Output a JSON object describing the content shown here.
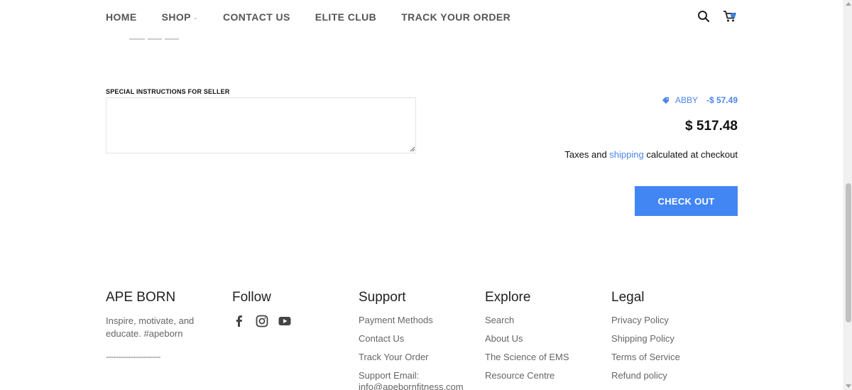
{
  "nav": {
    "home": "HOME",
    "shop": "SHOP",
    "contact": "CONTACT US",
    "elite": "ELITE CLUB",
    "track": "TRACK YOUR ORDER"
  },
  "header_icons": [
    "search-icon",
    "cart-icon"
  ],
  "accent_color": "#4286f4",
  "cart": {
    "special_instructions_label": "SPECIAL INSTRUCTIONS FOR SELLER",
    "special_instructions_value": "",
    "discount_code": "ABBY",
    "discount_amount": "-$ 57.49",
    "total": "$ 517.48",
    "taxes_prefix": "Taxes and",
    "taxes_link": "shipping",
    "taxes_suffix": "calculated at checkout",
    "checkout_label": "CHECK OUT"
  },
  "footer": {
    "brand": {
      "title": "APE BORN",
      "blurb": "Inspire, motivate, and educate. #apeborn",
      "dashes": "----------------------"
    },
    "follow": {
      "title": "Follow",
      "icons": [
        "facebook-icon",
        "instagram-icon",
        "youtube-icon"
      ]
    },
    "support": {
      "title": "Support",
      "items": [
        "Payment Methods",
        "Contact Us",
        "Track Your Order",
        "Support Email:",
        "info@apebornfitness.com"
      ]
    },
    "explore": {
      "title": "Explore",
      "items": [
        "Search",
        "About Us",
        "The Science of EMS",
        "Resource Centre"
      ]
    },
    "legal": {
      "title": "Legal",
      "items": [
        "Privacy Policy",
        "Shipping Policy",
        "Terms of Service",
        "Refund policy"
      ]
    }
  }
}
